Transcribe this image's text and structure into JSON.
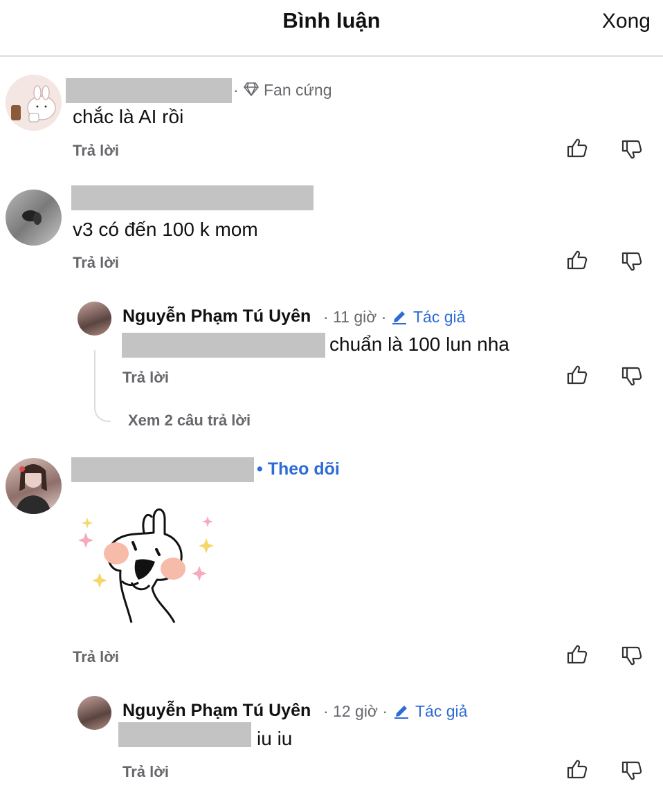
{
  "header": {
    "title": "Bình luận",
    "done_label": "Xong"
  },
  "comments": [
    {
      "badge_sep": "·",
      "badge_icon": "diamond-icon",
      "badge_label": "Fan cứng",
      "text": "chắc là AI rồi",
      "reply_label": "Trả lời",
      "actions": [
        "thumbs-up-icon",
        "thumbs-down-icon"
      ]
    },
    {
      "text": "v3 có đến 100 k mom",
      "reply_label": "Trả lời",
      "actions": [
        "thumbs-up-icon",
        "thumbs-down-icon"
      ],
      "reply": {
        "author": "Nguyễn Phạm Tú Uyên",
        "time": "· 11 giờ ·",
        "author_badge_icon": "pencil-icon",
        "author_badge": "Tác giả",
        "text": "chuẩn là 100 lun nha",
        "reply_label": "Trả lời",
        "view_replies": "Xem 2 câu trả lời"
      }
    },
    {
      "follow_label": "• Theo dõi",
      "sticker": "bunny-sparkle-sticker",
      "reply_label": "Trả lời",
      "actions": [
        "thumbs-up-icon",
        "thumbs-down-icon"
      ],
      "reply": {
        "author": "Nguyễn Phạm Tú Uyên",
        "time": "· 12 giờ ·",
        "author_badge_icon": "pencil-icon",
        "author_badge": "Tác giả",
        "text": "iu iu",
        "reply_label": "Trả lời"
      }
    }
  ],
  "colors": {
    "accent": "#2d6bd6",
    "muted": "#65676b",
    "redaction": "#c3c3c3",
    "divider": "#dcdcdc"
  }
}
